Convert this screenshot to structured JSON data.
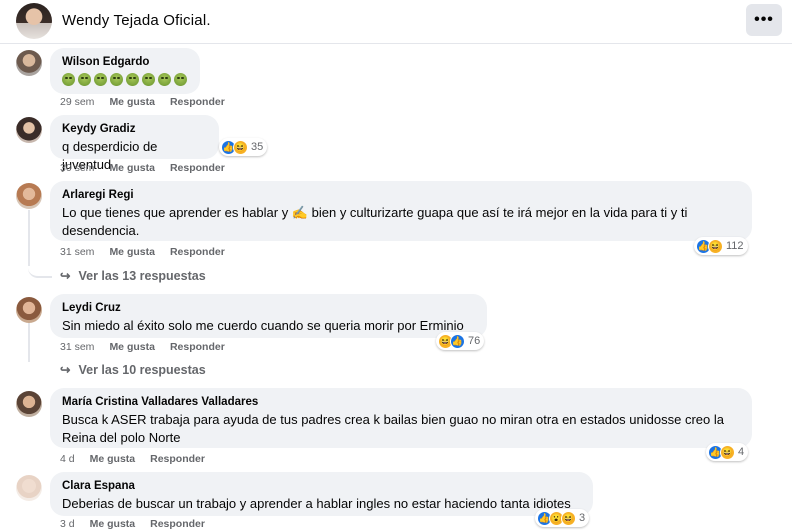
{
  "header": {
    "page_name": "Wendy Tejada Oficial.",
    "more_label": "•••"
  },
  "actions": {
    "like": "Me gusta",
    "reply": "Responder"
  },
  "comments": [
    {
      "author": "Wilson Edgardo",
      "text": "",
      "emoji_count": 8,
      "time": "29 sem",
      "reactions": [],
      "count": ""
    },
    {
      "author": "Keydy Gradiz",
      "text": "q desperdicio de juventud",
      "time": "30 sem",
      "reactions": [
        "like",
        "haha"
      ],
      "count": "35"
    },
    {
      "author": "Arlaregi Regi",
      "text": "Lo que tienes que aprender es hablar y ✍️ bien y culturizarte guapa que así te irá mejor en la vida para ti y ti desendencia.",
      "time": "31 sem",
      "reactions": [
        "like",
        "haha"
      ],
      "count": "112",
      "replies": "Ver las 13 respuestas"
    },
    {
      "author": "Leydi Cruz",
      "text": "Sin miedo al éxito solo me cuerdo cuando se queria morir por Erminio",
      "time": "31 sem",
      "reactions": [
        "haha",
        "like"
      ],
      "count": "76",
      "replies": "Ver las 10 respuestas"
    },
    {
      "author": "María Cristina Valladares Valladares",
      "text": "Busca k ASER trabaja para ayuda de tus padres crea k bailas bien guao no miran otra en estados unidosse creo la Reina del polo Norte",
      "time": "4 d",
      "reactions": [
        "like",
        "haha"
      ],
      "count": "4"
    },
    {
      "author": "Clara Espana",
      "text": "Deberias de buscar un trabajo y aprender a hablar ingles no estar haciendo tanta idiotes",
      "time": "3 d",
      "reactions": [
        "like",
        "wow",
        "haha"
      ],
      "count": "3"
    }
  ],
  "colors": {
    "bubble": "#f0f2f5",
    "secondary_text": "#65676b",
    "like_blue": "#1b74e4",
    "haha_yellow": "#f7b125"
  }
}
